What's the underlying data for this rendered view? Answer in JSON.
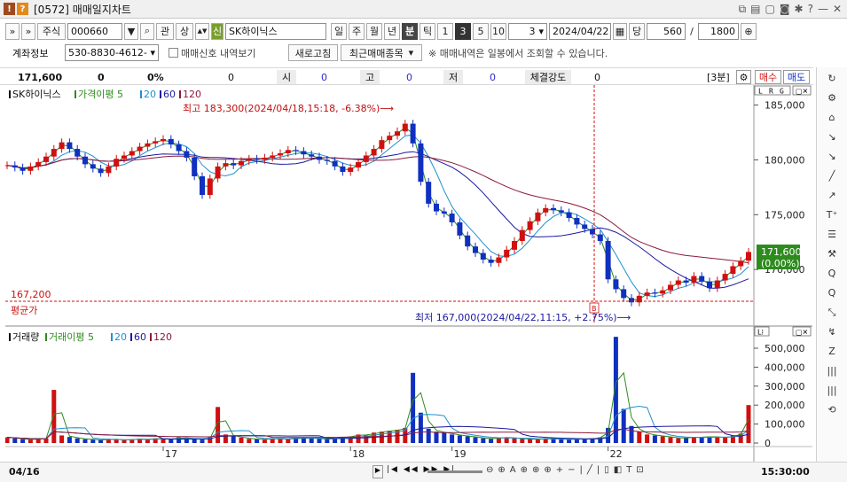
{
  "window": {
    "title_icons": [
      "!",
      "?"
    ],
    "title": "[0572] 매매일지차트",
    "right_icons": [
      "restore-icon",
      "copy-icon",
      "clipboard-icon",
      "camera-icon",
      "settings-icon",
      "help-icon",
      "minimize-icon",
      "close-icon"
    ]
  },
  "toolbar1": {
    "expand1": "»",
    "expand2": "»",
    "market": "주식",
    "code": "000660",
    "code_dropdown": "▼",
    "lookup": "⌕",
    "kwan": "관",
    "sang": "상",
    "updown": "▲▼",
    "sin_badge": "신",
    "stock_name": "SK하이닉스",
    "periods": [
      "일",
      "주",
      "월",
      "년",
      "분",
      "틱"
    ],
    "active_period": "분",
    "mins": [
      "1",
      "3",
      "5",
      "10"
    ],
    "active_min": "3",
    "interval_value": "3",
    "date": "2024/04/22",
    "dang": "당",
    "count": "560",
    "slash": "/",
    "max_count": "1800",
    "add": "⊕"
  },
  "toolbar2": {
    "account_label": "계좌정보",
    "account_value": "530-8830-4612-",
    "checkbox_label": "매매신호 내역보기",
    "refresh": "새로고침",
    "recent": "최근매매종목",
    "notice": "※ 매매내역은 일봉에서 조회할 수 있습니다."
  },
  "quote": {
    "price": "171,600",
    "change": "0",
    "rate": "0%",
    "vol": "0",
    "open_label": "시",
    "open": "0",
    "high_label": "고",
    "high": "0",
    "low_label": "저",
    "low": "0",
    "strength_label": "체결강도",
    "strength": "0",
    "period_tag": "[3분]",
    "buy": "매수",
    "sell": "매도"
  },
  "price_panel": {
    "legend": [
      {
        "text": "SK하이닉스",
        "color": "#111111"
      },
      {
        "text": "가격이평 5",
        "color": "#2e8b1e"
      },
      {
        "text": "20",
        "color": "#1e90d0"
      },
      {
        "text": "60",
        "color": "#1a1aa0"
      },
      {
        "text": "120",
        "color": "#8b1a3a"
      }
    ],
    "max_note": "최고 183,300(2024/04/18,15:18, -6.38%)⟶",
    "min_note": "최저 167,000(2024/04/22,11:15, +2.75%)⟶",
    "avg_price": "167,200",
    "avg_label": "평균가",
    "current_price": "171,600",
    "current_rate": "(0.00%)",
    "lrg": [
      "L",
      "R",
      "G"
    ],
    "mark": "B"
  },
  "volume_panel": {
    "legend": [
      {
        "text": "거래량",
        "color": "#111111"
      },
      {
        "text": "거래이평 5",
        "color": "#2e8b1e"
      },
      {
        "text": "20",
        "color": "#1e90d0"
      },
      {
        "text": "60",
        "color": "#1a1aa0"
      },
      {
        "text": "120",
        "color": "#8b1a3a"
      }
    ]
  },
  "chart_data": [
    {
      "type": "candlestick",
      "title": "SK하이닉스",
      "ylim": [
        165000,
        186500
      ],
      "y_ticks": [
        "185,000",
        "180,000",
        "175,000",
        "170,000"
      ],
      "x_tick_labels": [
        "04/16",
        "17",
        "18",
        "19",
        "22"
      ],
      "overlays": [
        "가격이평 5",
        "20",
        "60",
        "120"
      ],
      "close_series": [
        179500,
        179300,
        179000,
        179400,
        179800,
        180300,
        181000,
        181600,
        181000,
        180300,
        179600,
        179200,
        178800,
        179400,
        180100,
        180400,
        180800,
        181200,
        181500,
        181700,
        181900,
        181400,
        180800,
        180200,
        178500,
        176800,
        178300,
        179400,
        179700,
        179500,
        179900,
        180100,
        180000,
        180200,
        180400,
        180600,
        180900,
        180800,
        180500,
        180300,
        180000,
        179900,
        179400,
        178900,
        179300,
        179800,
        180400,
        181000,
        181800,
        182200,
        182600,
        183300,
        181500,
        178000,
        176000,
        175300,
        175100,
        174300,
        173100,
        172100,
        171500,
        170900,
        170600,
        171100,
        171800,
        172600,
        173600,
        174400,
        175200,
        175600,
        175400,
        175200,
        174700,
        174100,
        173700,
        173200,
        172600,
        169100,
        168200,
        167400,
        167000,
        167600,
        167900,
        167800,
        168100,
        168600,
        169000,
        168800,
        169400,
        168900,
        168300,
        169000,
        169600,
        170300,
        170800,
        171600
      ]
    },
    {
      "type": "bar",
      "title": "거래량",
      "ylim": [
        0,
        570000
      ],
      "y_ticks": [
        "500,000",
        "400,000",
        "300,000",
        "200,000",
        "100,000",
        "0"
      ],
      "values": [
        30000,
        25000,
        20000,
        18000,
        22000,
        25000,
        280000,
        40000,
        32000,
        25000,
        20000,
        18000,
        15000,
        22000,
        18000,
        15000,
        20000,
        22000,
        18000,
        25000,
        22000,
        20000,
        30000,
        25000,
        22000,
        18000,
        30000,
        190000,
        45000,
        35000,
        28000,
        22000,
        20000,
        18000,
        25000,
        22000,
        20000,
        30000,
        28000,
        25000,
        22000,
        20000,
        25000,
        30000,
        35000,
        45000,
        40000,
        55000,
        60000,
        65000,
        70000,
        80000,
        370000,
        160000,
        75000,
        60000,
        55000,
        45000,
        40000,
        35000,
        30000,
        25000,
        22000,
        28000,
        30000,
        25000,
        22000,
        20000,
        18000,
        25000,
        22000,
        20000,
        18000,
        22000,
        20000,
        25000,
        30000,
        80000,
        560000,
        180000,
        90000,
        60000,
        45000,
        40000,
        35000,
        30000,
        25000,
        28000,
        32000,
        30000,
        35000,
        30000,
        28000,
        40000,
        50000,
        200000
      ]
    }
  ],
  "bottom": {
    "date_label": "04/16",
    "time_label": "15:30:00",
    "scroll_icons": [
      "◀",
      "▶",
      "|◀",
      "◀◀",
      "▶▶",
      "▶|"
    ],
    "tool_glyphs": [
      "⊖",
      "⊕",
      "A",
      "⊕",
      "⊕",
      "⊕",
      "+",
      "−",
      "|",
      "╱",
      "|",
      "▯",
      "◧",
      "T",
      "⊡"
    ]
  },
  "right_tools": [
    "↻",
    "⚙",
    "⌂",
    "↘",
    "↘",
    "╱",
    "↗",
    "T⁺",
    "☰",
    "⚒",
    "Q",
    "Q",
    "⤡",
    "↯",
    "Z",
    "|||",
    "|||",
    "⟲"
  ]
}
